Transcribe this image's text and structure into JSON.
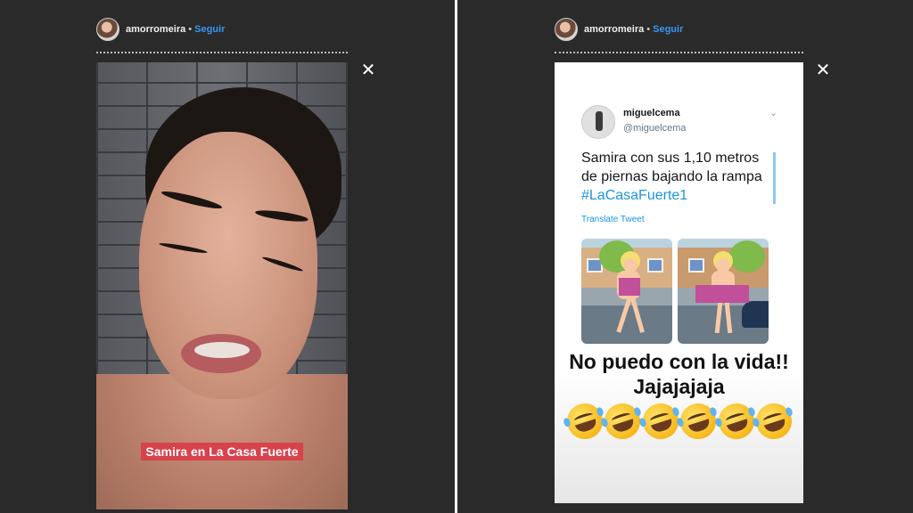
{
  "left_panel": {
    "username": "amorromeira",
    "separator": "•",
    "follow_label": "Seguir",
    "close_icon": "close-icon",
    "caption": "Samira en La Casa Fuerte"
  },
  "right_panel": {
    "username": "amorromeira",
    "separator": "•",
    "follow_label": "Seguir",
    "close_icon": "close-icon",
    "tweet": {
      "display_name": "miguelcema",
      "handle": "@miguelcema",
      "text": "Samira con sus 1,10 metros de piernas bajando la rampa ",
      "hashtag": "#LaCasaFuerte1",
      "translate_label": "Translate Tweet",
      "chevron_icon": "chevron-down-icon"
    },
    "overlay_line1": "No puedo con la vida!!",
    "overlay_line2": "Jajajajaja",
    "emoji_icon": "rolling-on-floor-laughing-emoji",
    "emoji_count": 6
  },
  "colors": {
    "background": "#2a2a2a",
    "follow": "#3897f0",
    "caption_bg": "#d8424d",
    "twitter_link": "#1b95e0"
  }
}
